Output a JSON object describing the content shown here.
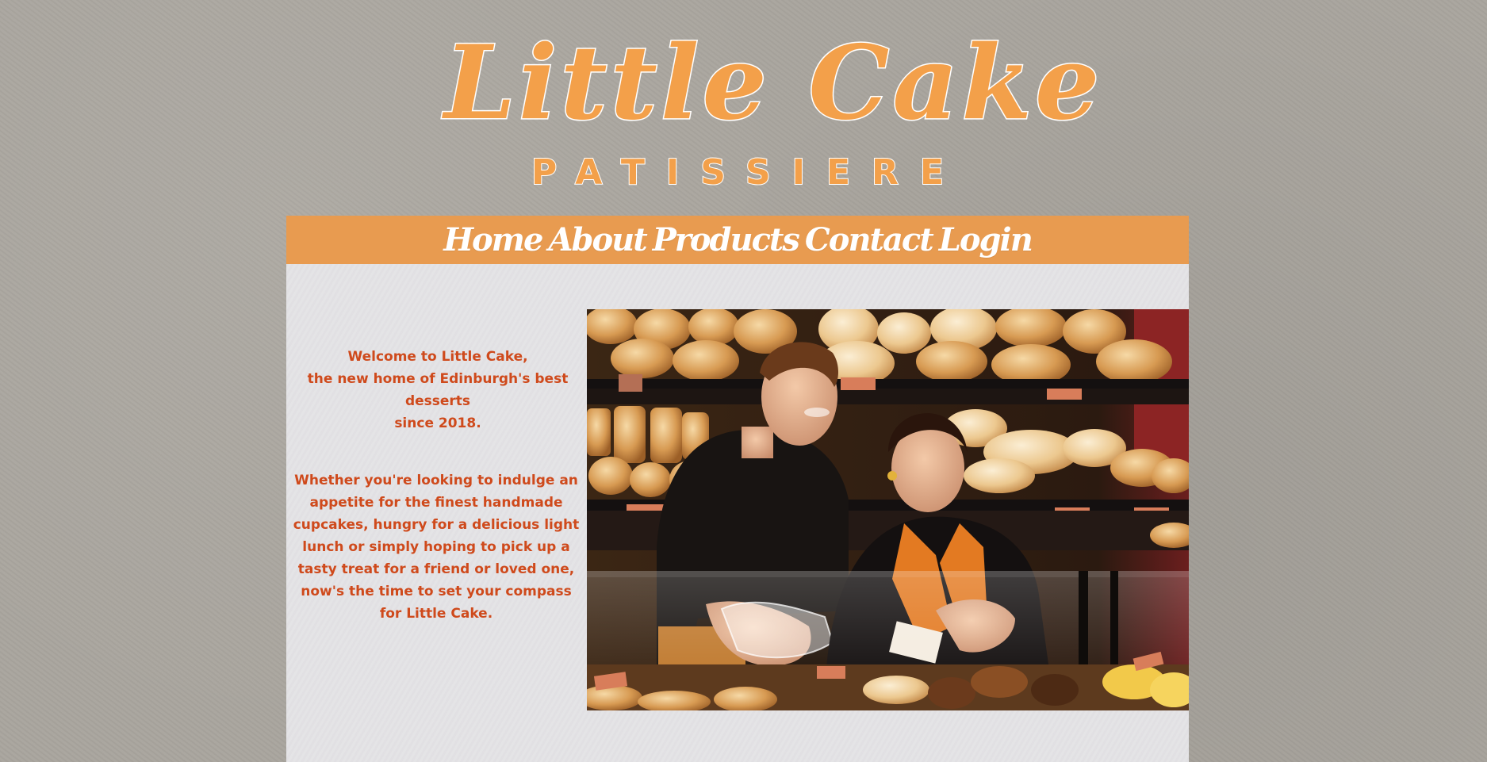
{
  "logo": {
    "title": "Little Cake",
    "subtitle": "PATISSIERE"
  },
  "nav": {
    "items": [
      "Home",
      "About",
      "Products",
      "Contact",
      "Login"
    ]
  },
  "welcome": {
    "line1": "Welcome to Little Cake,",
    "line2": "the new home of Edinburgh's best desserts",
    "line3": "since 2018."
  },
  "intro": {
    "text": "Whether you're looking to indulge an appetite for the finest handmade cupcakes, hungry for a delicious light lunch or simply hoping to pick up a tasty treat for a friend or loved one, now's the time to set your compass for Little Cake."
  },
  "colors": {
    "accent": "#e89b50",
    "logo": "#f3a04a",
    "text": "#cf4a1c",
    "panel": "#e4e3e6",
    "background": "#a9a59e"
  },
  "photo": {
    "icon": "bakery-staff-photo"
  }
}
